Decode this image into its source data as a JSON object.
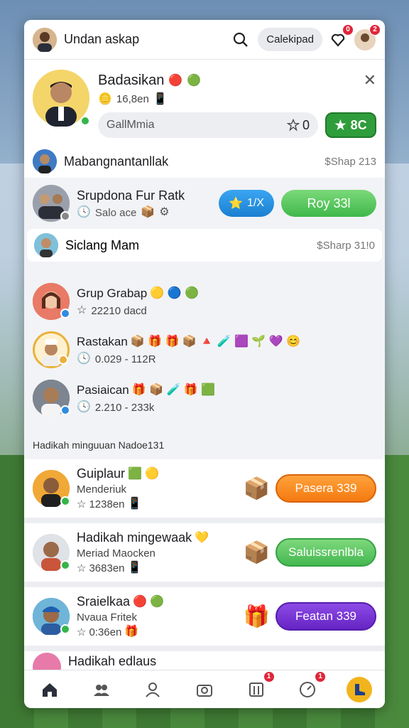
{
  "topbar": {
    "title": "Undan askap",
    "pill_label": "Calekipad",
    "heart_badge": "0",
    "avatar_badge": "2"
  },
  "profile": {
    "name": "Badasikan",
    "sub": "16,8en",
    "input_value": "GallMmia",
    "star_count": "0",
    "action_label": "8C"
  },
  "row_one": {
    "label": "Mabangnantanllak",
    "meta": "$Shap 213"
  },
  "group": {
    "name": "Srupdona Fur Ratk",
    "sub": "Salo ace",
    "blue_label": "1/X",
    "green_label": "Roy 33l"
  },
  "row_two": {
    "label": "Siclang Mam",
    "meta": "$Sharp 31!0"
  },
  "list": [
    {
      "name": "Grup Grabap",
      "sub": "22210 dacd",
      "emojis": "🟡 🔵 🟢"
    },
    {
      "name": "Rastakan",
      "sub": "0.029 - 112R",
      "emojis": "📦 🎁 🎁 📦 🔺 🧪 🟪 🌱 💜 😊"
    },
    {
      "name": "Pasiaican",
      "sub": "2.210 - 233k",
      "emojis": "🎁 📦 🧪 🎁 🟩"
    }
  ],
  "section_title": "Hadikah minguuan  Nadoe131",
  "offers": [
    {
      "name": "Guiplaur",
      "s1": "Menderiuk",
      "s2": "1238en",
      "button": "Pasera 339",
      "box": "📦",
      "emojis": "🟩 🟡"
    },
    {
      "name": "Hadikah mingewaak",
      "s1": "Meriad Maocken",
      "s2": "3683en",
      "button": "Saluissrenlbla",
      "box": "📦",
      "emojis": "💛"
    },
    {
      "name": "Sraielkaa",
      "s1": "Nvaua Fritek",
      "s2": "0:36en",
      "button": "Featan 339",
      "box": "🎁",
      "emojis": "🔴 🟢"
    }
  ],
  "peek_name": "Hadikah edlaus",
  "nav": {
    "badge_one": "1",
    "badge_two": "1"
  },
  "colors": {
    "accent_green": "#2f9d3b",
    "accent_orange": "#f47a10",
    "accent_purple": "#6624c4",
    "badge_red": "#e0263a"
  }
}
